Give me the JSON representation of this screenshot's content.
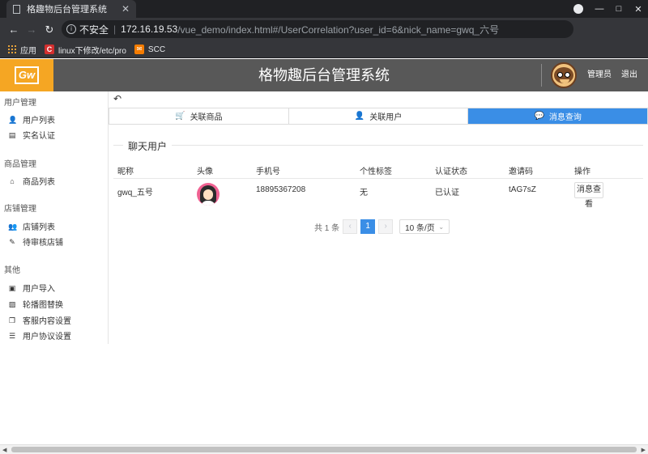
{
  "browser": {
    "tab_title": "格趣物后台管理系统",
    "tab_close": "✕",
    "insecure_label": "不安全",
    "url_host": "172.16.19.53",
    "url_path": "/vue_demo/index.html#/UserCorrelation?user_id=6&nick_name=gwq_六号",
    "bookmarks": [
      {
        "label": "应用",
        "icon": "apps-grid-icon"
      },
      {
        "label": "linux下修改/etc/pro",
        "icon": "red-c-icon"
      },
      {
        "label": "SCC",
        "icon": "orange-mail-icon"
      }
    ]
  },
  "header": {
    "logo_text": "Gw",
    "title": "格物趣后台管理系统",
    "user_label": "管理员",
    "logout_label": "退出"
  },
  "sidebar": {
    "groups": [
      {
        "title": "用户管理",
        "items": [
          "用户列表",
          "实名认证"
        ]
      },
      {
        "title": "商品管理",
        "items": [
          "商品列表"
        ]
      },
      {
        "title": "店铺管理",
        "items": [
          "店铺列表",
          "待审核店铺"
        ]
      },
      {
        "title": "其他",
        "items": [
          "用户导入",
          "轮播图替换",
          "客服内容设置",
          "用户协议设置"
        ]
      }
    ]
  },
  "tabs": [
    {
      "label": "关联商品",
      "icon": "cart-icon",
      "active": false
    },
    {
      "label": "关联用户",
      "icon": "user-icon",
      "active": false
    },
    {
      "label": "消息查询",
      "icon": "chat-icon",
      "active": true
    }
  ],
  "section_title": "聊天用户",
  "table": {
    "columns": [
      "昵称",
      "头像",
      "手机号",
      "个性标签",
      "认证状态",
      "邀请码",
      "操作"
    ],
    "rows": [
      {
        "nickname": "gwq_五号",
        "phone": "18895367208",
        "tag": "无",
        "status": "已认证",
        "invite_code": "tAG7sZ",
        "action": "消息查看"
      }
    ]
  },
  "pagination": {
    "total_label": "共 1 条",
    "current_page": "1",
    "page_size": "10 条/页"
  },
  "colors": {
    "accent": "#3a8ee6",
    "logo_bg": "#f5a623",
    "header_bg": "#585858"
  }
}
